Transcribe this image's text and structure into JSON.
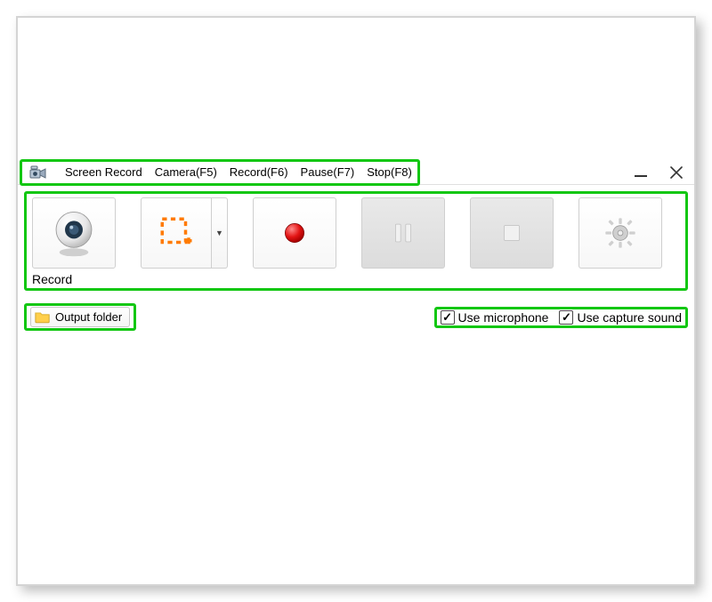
{
  "menu": {
    "title": "Screen Record",
    "items": [
      "Camera(F5)",
      "Record(F6)",
      "Pause(F7)",
      "Stop(F8)"
    ]
  },
  "window": {
    "minimize_label": "Minimize",
    "close_label": "Close"
  },
  "toolbar": {
    "record_label": "Record"
  },
  "output": {
    "button_label": "Output folder"
  },
  "options": {
    "use_microphone_label": "Use microphone",
    "use_microphone_checked": true,
    "use_capture_sound_label": "Use capture sound",
    "use_capture_sound_checked": true
  },
  "colors": {
    "highlight": "#13c713"
  }
}
